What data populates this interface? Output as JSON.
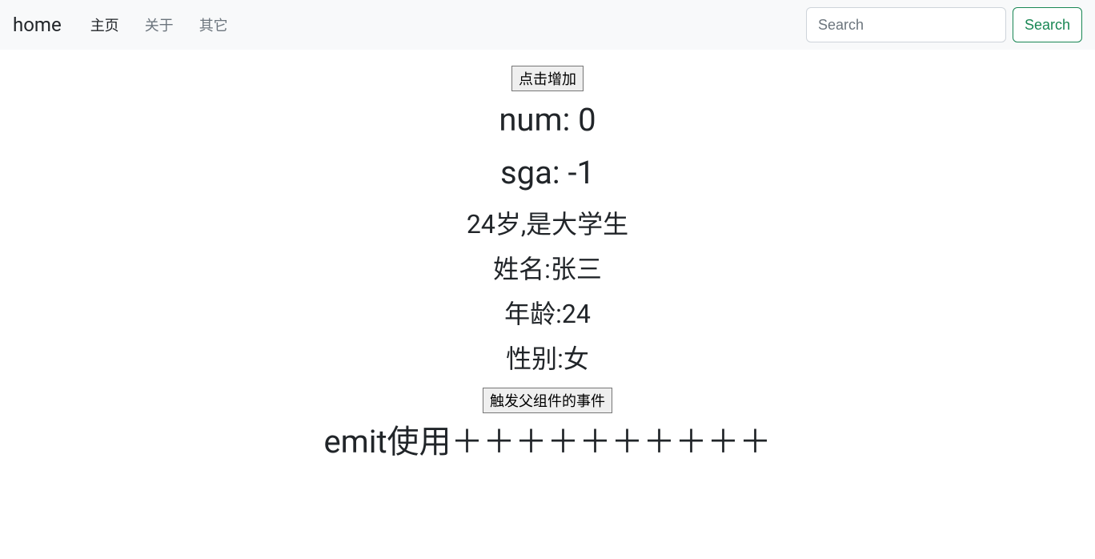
{
  "nav": {
    "brand": "home",
    "links": [
      {
        "label": "主页",
        "active": true
      },
      {
        "label": "关于",
        "active": false
      },
      {
        "label": "其它",
        "active": false
      }
    ],
    "search_placeholder": "Search",
    "search_button": "Search"
  },
  "main": {
    "increment_button": "点击增加",
    "num_label": "num: 0",
    "sga_label": "sga: -1",
    "desc": "24岁,是大学生",
    "name_line": "姓名:张三",
    "age_line": "年龄:24",
    "gender_line": "性别:女",
    "emit_button": "触发父组件的事件",
    "emit_text": "emit使用＋＋＋＋＋＋＋＋＋＋"
  }
}
